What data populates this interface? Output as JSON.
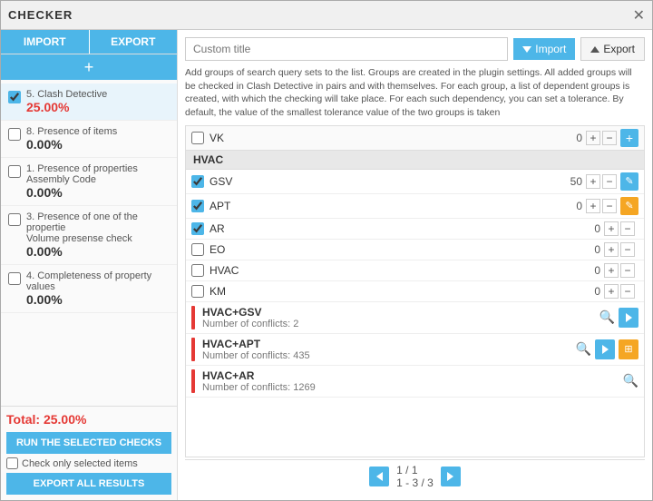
{
  "window": {
    "title": "CHECKER"
  },
  "left_panel": {
    "import_label": "IMPORT",
    "export_label": "EXPORT",
    "add_label": "+",
    "checks": [
      {
        "id": "5",
        "name": "5. Clash Detective",
        "value": "25.00%",
        "checked": true,
        "selected": true,
        "value_color": "red"
      },
      {
        "id": "8",
        "name": "8. Presence of items",
        "value": "0.00%",
        "checked": false,
        "selected": false,
        "value_color": "default"
      },
      {
        "id": "1",
        "name": "1. Presence of properties\nAssembly Code",
        "value": "0.00%",
        "checked": false,
        "selected": false,
        "value_color": "default"
      },
      {
        "id": "3",
        "name": "3. Presence of one of the propertie\nVolume presense check",
        "value": "0.00%",
        "checked": false,
        "selected": false,
        "value_color": "default"
      },
      {
        "id": "4",
        "name": "4. Completeness of property values",
        "value": "0.00%",
        "checked": false,
        "selected": false,
        "value_color": "default"
      }
    ],
    "total_label": "Total: 25.00%",
    "run_btn_label": "RUN THE SELECTED CHECKS",
    "check_only_label": "Check only selected items",
    "export_all_label": "EXPORT ALL RESULTS"
  },
  "right_panel": {
    "custom_title_placeholder": "Custom title",
    "import_btn_label": "Import",
    "export_btn_label": "Export",
    "description": "Add groups of search query sets to the list. Groups are created in the plugin settings. All added groups will be checked in Clash Detective in pairs and with themselves. For each group, a list of dependent groups is created, with which the checking will take place. For each such dependency, you can set a tolerance. By default, the value of the smallest tolerance value of the two groups is taken",
    "vk_row": {
      "label": "VK",
      "value": "0"
    },
    "hvac_group": {
      "header": "HVAC",
      "rows": [
        {
          "label": "GSV",
          "value": "50",
          "checked": true
        },
        {
          "label": "APT",
          "value": "0",
          "checked": true
        },
        {
          "label": "AR",
          "value": "0",
          "checked": true
        },
        {
          "label": "EO",
          "value": "0",
          "checked": false
        },
        {
          "label": "HVAC",
          "value": "0",
          "checked": false
        },
        {
          "label": "KM",
          "value": "0",
          "checked": false
        }
      ]
    },
    "conflicts": [
      {
        "title": "HVAC+GSV",
        "count_label": "Number of conflicts: 2",
        "has_arrow": true,
        "has_grid": false
      },
      {
        "title": "HVAC+APT",
        "count_label": "Number of conflicts: 435",
        "has_arrow": true,
        "has_grid": true
      },
      {
        "title": "HVAC+AR",
        "count_label": "Number of conflicts: 1269",
        "has_arrow": false,
        "has_grid": false
      }
    ],
    "pagination": {
      "current": "1 / 1",
      "range": "1 - 3 / 3"
    }
  }
}
